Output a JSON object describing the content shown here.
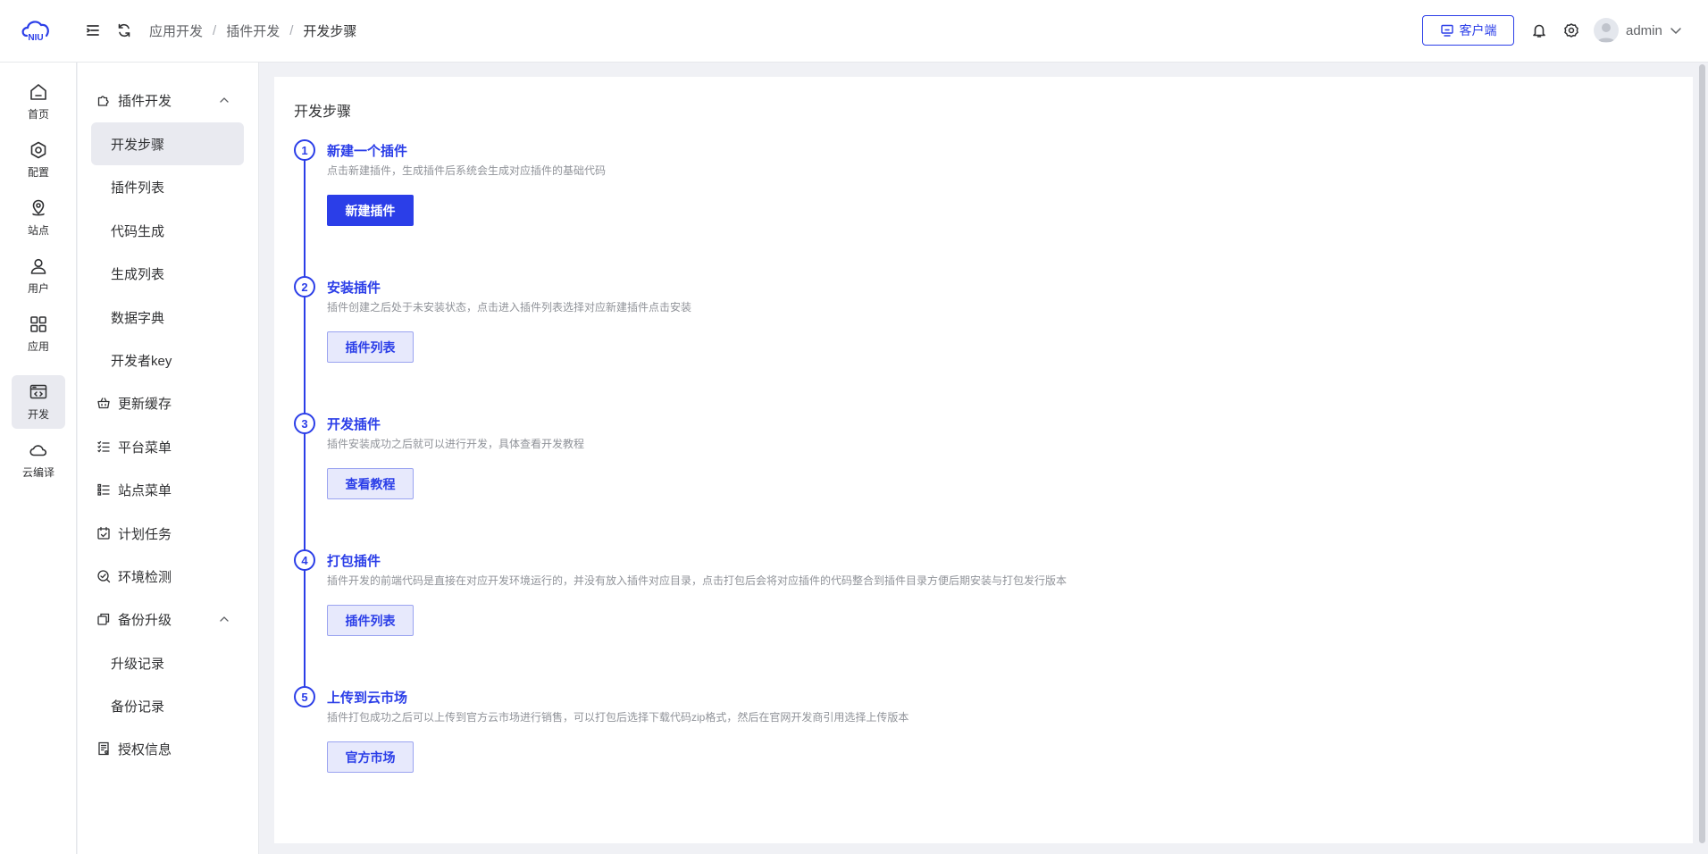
{
  "header": {
    "logo_text": "NIU",
    "breadcrumb": [
      "应用开发",
      "插件开发",
      "开发步骤"
    ],
    "client_button": "客户端",
    "username": "admin"
  },
  "rail": {
    "items": [
      {
        "label": "首页",
        "icon": "home-icon"
      },
      {
        "label": "配置",
        "icon": "hexagon-settings-icon"
      },
      {
        "label": "站点",
        "icon": "location-pin-icon"
      },
      {
        "label": "用户",
        "icon": "user-icon"
      },
      {
        "label": "应用",
        "icon": "grid-apps-icon"
      },
      {
        "label": "开发",
        "icon": "code-window-icon",
        "active": true
      },
      {
        "label": "云编译",
        "icon": "cloud-icon"
      }
    ]
  },
  "submenu": {
    "plugin_dev": {
      "label": "插件开发",
      "children": [
        "开发步骤",
        "插件列表",
        "代码生成",
        "生成列表",
        "数据字典",
        "开发者key"
      ]
    },
    "update_cache": "更新缓存",
    "platform_menu": "平台菜单",
    "site_menu": "站点菜单",
    "scheduled_tasks": "计划任务",
    "env_check": "环境检测",
    "backup_upgrade": {
      "label": "备份升级",
      "children": [
        "升级记录",
        "备份记录"
      ]
    },
    "license_info": "授权信息"
  },
  "main": {
    "title": "开发步骤",
    "steps": [
      {
        "num": "1",
        "title": "新建一个插件",
        "desc": "点击新建插件，生成插件后系统会生成对应插件的基础代码",
        "button": "新建插件"
      },
      {
        "num": "2",
        "title": "安装插件",
        "desc": "插件创建之后处于未安装状态，点击进入插件列表选择对应新建插件点击安装",
        "button": "插件列表"
      },
      {
        "num": "3",
        "title": "开发插件",
        "desc": "插件安装成功之后就可以进行开发，具体查看开发教程",
        "button": "查看教程"
      },
      {
        "num": "4",
        "title": "打包插件",
        "desc": "插件开发的前端代码是直接在对应开发环境运行的，并没有放入插件对应目录，点击打包后会将对应插件的代码整合到插件目录方便后期安装与打包发行版本",
        "button": "插件列表"
      },
      {
        "num": "5",
        "title": "上传到云市场",
        "desc": "插件打包成功之后可以上传到官方云市场进行销售，可以打包后选择下载代码zip格式，然后在官网开发商引用选择上传版本",
        "button": "官方市场"
      }
    ]
  },
  "colors": {
    "accent": "#2b3ee8",
    "active_bg": "#e9eaf0"
  }
}
